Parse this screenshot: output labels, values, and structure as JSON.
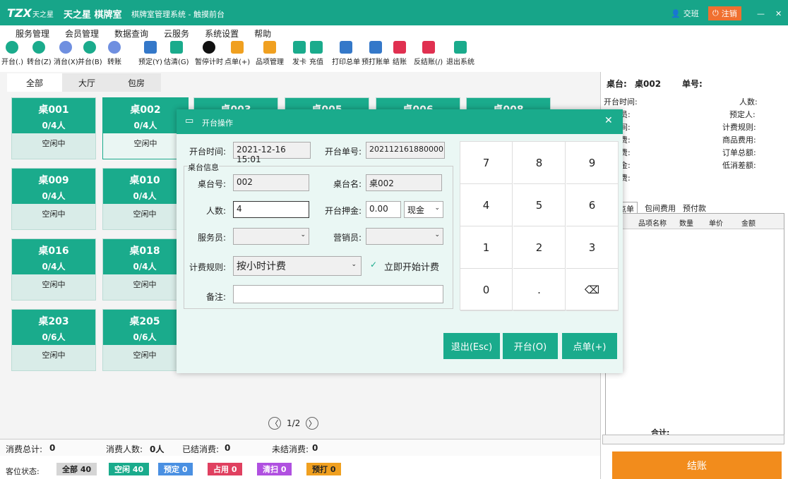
{
  "window": {
    "logo": "TZX",
    "brand": "天之星",
    "title": "天之星 棋牌室",
    "system": "棋牌室管理系统 - 触摸前台",
    "shift": "交班",
    "logout": "注销",
    "minimize": "—",
    "close": "✕"
  },
  "menu": [
    "服务管理",
    "会员管理",
    "数据查询",
    "云服务",
    "系统设置",
    "帮助"
  ],
  "toolbar": [
    {
      "label": "开台(.)",
      "icon": "play-icon",
      "color": "#1aab8c"
    },
    {
      "label": "转台(Z)",
      "icon": "transfer-icon",
      "color": "#1aab8c"
    },
    {
      "label": "消台(X)",
      "icon": "clear-table-icon",
      "color": "#6f8fe0"
    },
    {
      "label": "并台(B)",
      "icon": "merge-icon",
      "color": "#1aab8c"
    },
    {
      "label": "转账",
      "icon": "transfer-money-icon",
      "color": "#6f8fe0"
    },
    {
      "label": "预定(Y)",
      "icon": "calendar-icon",
      "color": "#3478c9"
    },
    {
      "label": "估清(G)",
      "icon": "sold-out-icon",
      "color": "#1aab8c"
    },
    {
      "label": "暂停计时",
      "icon": "pause-icon",
      "color": "#111"
    },
    {
      "label": "点单(+)",
      "icon": "order-icon",
      "color": "#f0a020"
    },
    {
      "label": "品项管理",
      "icon": "tag-icon",
      "color": "#f0a020"
    },
    {
      "label": "发卡",
      "icon": "card-icon",
      "color": "#1aab8c"
    },
    {
      "label": "充值",
      "icon": "recharge-icon",
      "color": "#1aab8c"
    },
    {
      "label": "打印总单",
      "icon": "print-bill-icon",
      "color": "#3478c9"
    },
    {
      "label": "预打账单",
      "icon": "preprint-icon",
      "color": "#3478c9"
    },
    {
      "label": "结账",
      "icon": "checkout-icon",
      "color": "#e03050"
    },
    {
      "label": "反结账(/)",
      "icon": "reverse-checkout-icon",
      "color": "#e03050"
    },
    {
      "label": "退出系统",
      "icon": "exit-icon",
      "color": "#1aab8c"
    }
  ],
  "tabs": [
    "全部",
    "大厅",
    "包房"
  ],
  "tables": [
    {
      "name": "桌001",
      "cap": "0/4人",
      "status": "空闲中"
    },
    {
      "name": "桌002",
      "cap": "0/4人",
      "status": "空闲中"
    },
    {
      "name": "桌003"
    },
    {
      "name": "桌005"
    },
    {
      "name": "桌006"
    },
    {
      "name": "桌008"
    },
    {
      "name": "桌009",
      "cap": "0/4人",
      "status": "空闲中"
    },
    {
      "name": "桌010",
      "cap": "0/4人",
      "status": "空闲中"
    },
    {
      "name": "桌016",
      "cap": "0/4人",
      "status": "空闲中"
    },
    {
      "name": "桌018",
      "cap": "0/4人",
      "status": "空闲中"
    },
    {
      "name": "桌203",
      "cap": "0/6人",
      "status": "空闲中"
    },
    {
      "name": "桌205",
      "cap": "0/6人",
      "status": "空闲中"
    }
  ],
  "pager": {
    "text": "1/2",
    "prev": "〈",
    "next": "〉"
  },
  "summary": {
    "total_label": "消费总计:",
    "total": "0",
    "people_label": "消费人数:",
    "people": "0人",
    "settled_label": "已结消费:",
    "settled": "0",
    "unsettled_label": "未结消费:",
    "unsettled": "0"
  },
  "status": {
    "label": "客位状态:",
    "all": "全部 40",
    "free": "空闲 40",
    "reserved": "预定 0",
    "occupied": "占用 0",
    "cleaning": "清扫 0",
    "preprint": "预打 0"
  },
  "right": {
    "table_label": "桌台:",
    "table": "桌002",
    "order_label": "单号:",
    "open_time": "开台时间:",
    "people": "人数:",
    "waiter": "务员:",
    "reserver": "预定人:",
    "time": "时间:",
    "rule": "计费规则:",
    "room_fee": "间费:",
    "goods_fee": "商品费用:",
    "service_fee": "务费:",
    "order_total": "订单总额:",
    "deposit": "押金:",
    "min_diff": "低消差额:",
    "consume": "消费:",
    "tabs": [
      "点单",
      "包间费用",
      "预付款"
    ],
    "cols": [
      "品项名称",
      "数量",
      "单价",
      "金额"
    ],
    "total": "合计:",
    "checkout": "结账"
  },
  "dialog": {
    "title": "开台操作",
    "open_time_label": "开台时间:",
    "open_time": "2021-12-16 15:01",
    "order_no_label": "开台单号:",
    "order_no": "202112161880000",
    "info_title": "桌台信息",
    "table_no_label": "桌台号:",
    "table_no": "002",
    "table_name_label": "桌台名:",
    "table_name": "桌002",
    "people_label": "人数:",
    "people": "4",
    "deposit_label": "开台押金:",
    "deposit": "0.00",
    "pay": "现金",
    "waiter_label": "服务员:",
    "sales_label": "营销员:",
    "rule_label": "计费规则:",
    "rule": "按小时计费",
    "start_now": "立即开始计费",
    "remark_label": "备注:",
    "keys": [
      "7",
      "8",
      "9",
      "4",
      "5",
      "6",
      "1",
      "2",
      "3",
      "0",
      ".",
      "⌫"
    ],
    "exit": "退出(Esc)",
    "open": "开台(O)",
    "order": "点单(+)",
    "close": "✕"
  }
}
